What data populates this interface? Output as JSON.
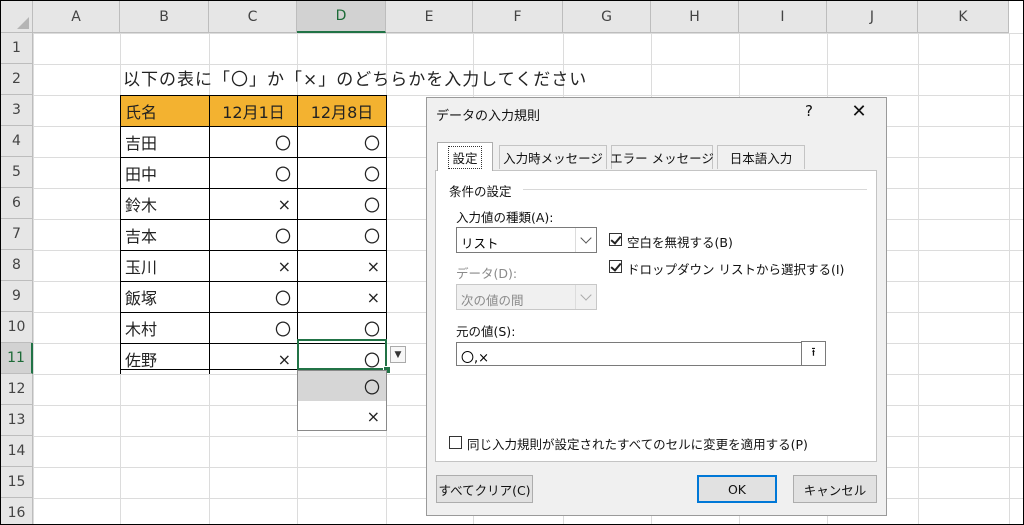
{
  "sheet": {
    "columns": [
      "A",
      "B",
      "C",
      "D",
      "E",
      "F",
      "G",
      "H",
      "I",
      "J",
      "K"
    ],
    "selected_column": "D",
    "rows": [
      "1",
      "2",
      "3",
      "4",
      "5",
      "6",
      "7",
      "8",
      "9",
      "10",
      "11",
      "12",
      "13",
      "14",
      "15",
      "16"
    ],
    "selected_row": "11",
    "instruction": "以下の表に「〇」か「×」のどちらかを入力してください",
    "table": {
      "headers": [
        "氏名",
        "12月1日",
        "12月8日"
      ],
      "rows": [
        {
          "name": "吉田",
          "d1": "〇",
          "d8": "〇"
        },
        {
          "name": "田中",
          "d1": "〇",
          "d8": "〇"
        },
        {
          "name": "鈴木",
          "d1": "×",
          "d8": "〇"
        },
        {
          "name": "吉本",
          "d1": "〇",
          "d8": "〇"
        },
        {
          "name": "玉川",
          "d1": "×",
          "d8": "×"
        },
        {
          "name": "飯塚",
          "d1": "〇",
          "d8": "×"
        },
        {
          "name": "木村",
          "d1": "〇",
          "d8": "〇"
        },
        {
          "name": "佐野",
          "d1": "×",
          "d8": "〇"
        }
      ]
    },
    "dropdown_arrow": "▼",
    "dropdown_options": [
      "〇",
      "×"
    ],
    "header_color": "#f3b230",
    "accent_color": "#217346"
  },
  "dialog": {
    "title": "データの入力規則",
    "help": "?",
    "close": "✕",
    "tabs": [
      "設定",
      "入力時メッセージ",
      "エラー メッセージ",
      "日本語入力"
    ],
    "group_label": "条件の設定",
    "allow_label": "入力値の種類(A):",
    "allow_value": "リスト",
    "data_label": "データ(D):",
    "data_value": "次の値の間",
    "ignore_blank": "空白を無視する(B)",
    "in_cell_dropdown": "ドロップダウン リストから選択する(I)",
    "source_label": "元の値(S):",
    "source_value": "〇,×",
    "source_button": "⭱",
    "apply_all": "同じ入力規則が設定されたすべてのセルに変更を適用する(P)",
    "clear_all": "すべてクリア(C)",
    "ok": "OK",
    "cancel": "キャンセル"
  }
}
